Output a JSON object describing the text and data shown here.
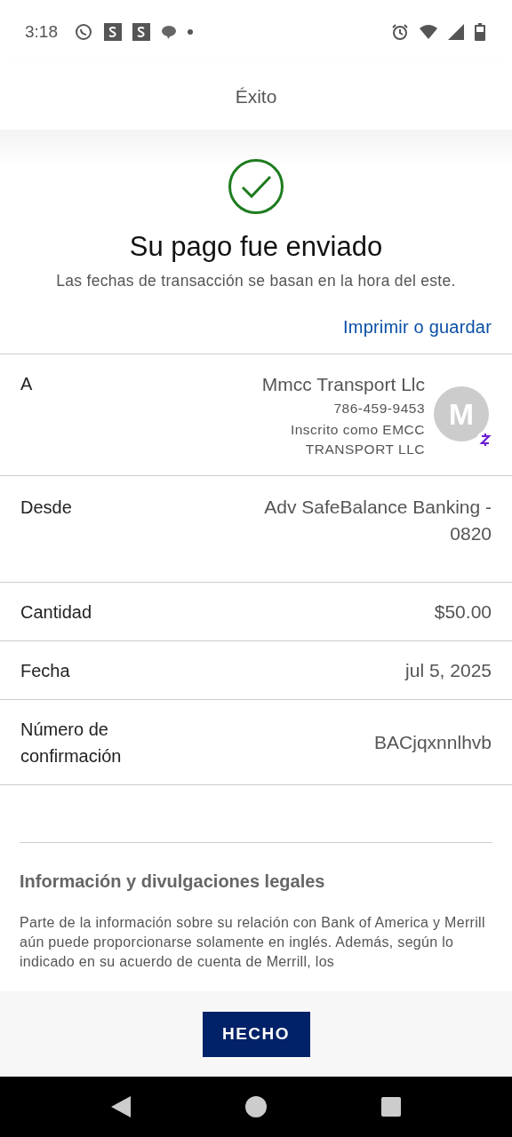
{
  "status_bar": {
    "time": "3:18"
  },
  "header": {
    "title": "Éxito"
  },
  "success": {
    "title": "Su pago fue enviado",
    "subtitle": "Las fechas de transacción se basan en la hora del este.",
    "link": "Imprimir o guardar"
  },
  "recipient": {
    "label": "A",
    "name": "Mmcc Transport Llc",
    "phone": "786-459-9453",
    "enrolled": "Inscrito como EMCC TRANSPORT LLC",
    "avatar": "M"
  },
  "details": [
    {
      "label": "Desde",
      "value": "Adv SafeBalance Banking - 0820"
    },
    {
      "label": "Cantidad",
      "value": "$50.00"
    },
    {
      "label": "Fecha",
      "value": "jul 5, 2025"
    },
    {
      "label": "Número de confirmación",
      "value": "BACjqxnnlhvb"
    }
  ],
  "legal": {
    "title": "Información y divulgaciones legales",
    "text": "Parte de la información sobre su relación con Bank of America y Merrill aún puede proporcionarse solamente en inglés. Además, según lo indicado en su acuerdo de cuenta de Merrill, los"
  },
  "footer": {
    "button": "HECHO"
  }
}
